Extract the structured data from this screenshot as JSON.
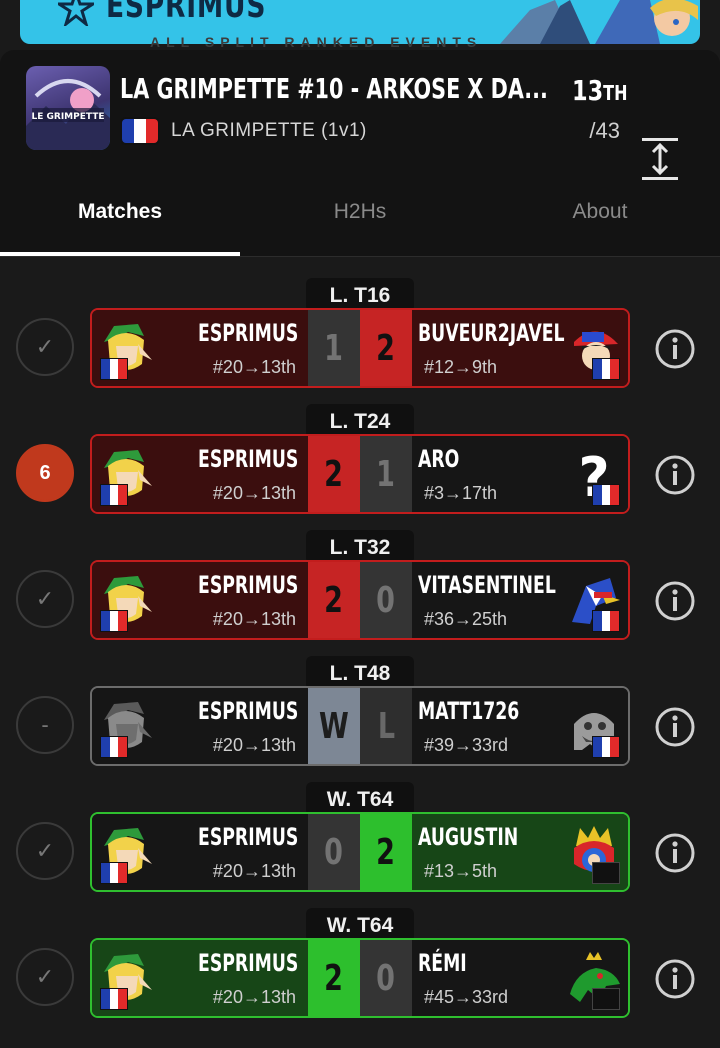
{
  "banner": {
    "title": "ESPRIMUS",
    "nav_tabs": "ALL  SPLIT  RANKED  EVENTS"
  },
  "header": {
    "title": "LA GRIMPETTE #10 - ARKOSE X DA...",
    "event": "LA GRIMPETTE (1v1)",
    "placement_number": "13",
    "placement_suffix": "TH",
    "entrants": "/43"
  },
  "tabs": [
    {
      "label": "Matches",
      "active": true
    },
    {
      "label": "H2Hs",
      "active": false
    },
    {
      "label": "About",
      "active": false
    }
  ],
  "matches": [
    {
      "round": "L. T16",
      "status": "check",
      "left": {
        "name": "ESPRIMUS",
        "seed": "#20→13th",
        "char": "link-icon"
      },
      "right": {
        "name": "BUVEUR2JAVEL",
        "seed": "#12→9th",
        "char": "ness-icon"
      },
      "score_left": "1",
      "score_right": "2",
      "result": "lose"
    },
    {
      "round": "L. T24",
      "status": "6",
      "left": {
        "name": "ESPRIMUS",
        "seed": "#20→13th",
        "char": "link-icon"
      },
      "right": {
        "name": "ARO",
        "seed": "#3→17th",
        "char": "random-icon"
      },
      "score_left": "2",
      "score_right": "1",
      "result": "lose"
    },
    {
      "round": "L. T32",
      "status": "check",
      "left": {
        "name": "ESPRIMUS",
        "seed": "#20→13th",
        "char": "link-icon"
      },
      "right": {
        "name": "VITASENTINEL",
        "seed": "#36→25th",
        "char": "falco-icon"
      },
      "score_left": "2",
      "score_right": "0",
      "result": "lose"
    },
    {
      "round": "L. T48",
      "status": "dash",
      "left": {
        "name": "ESPRIMUS",
        "seed": "#20→13th",
        "char": "link-icon"
      },
      "right": {
        "name": "MATT1726",
        "seed": "#39→33rd",
        "char": "king-boo-icon"
      },
      "score_left": "W",
      "score_right": "L",
      "result": "dq"
    },
    {
      "round": "W. T64",
      "status": "check",
      "left": {
        "name": "ESPRIMUS",
        "seed": "#20→13th",
        "char": "link-icon"
      },
      "right": {
        "name": "AUGUSTIN",
        "seed": "#13→5th",
        "char": "king-dedede-icon"
      },
      "score_left": "0",
      "score_right": "2",
      "result": "win-right"
    },
    {
      "round": "W. T64",
      "status": "check",
      "left": {
        "name": "ESPRIMUS",
        "seed": "#20→13th",
        "char": "link-icon"
      },
      "right": {
        "name": "RÉMI",
        "seed": "#45→33rd",
        "char": "king-k-rool-icon"
      },
      "score_left": "2",
      "score_right": "0",
      "result": "win"
    }
  ],
  "status_symbols": {
    "check": "✓",
    "dash": "-"
  },
  "colors": {
    "lose": "#c21d1d",
    "win": "#2fbf2f",
    "banner": "#34c3e8"
  }
}
